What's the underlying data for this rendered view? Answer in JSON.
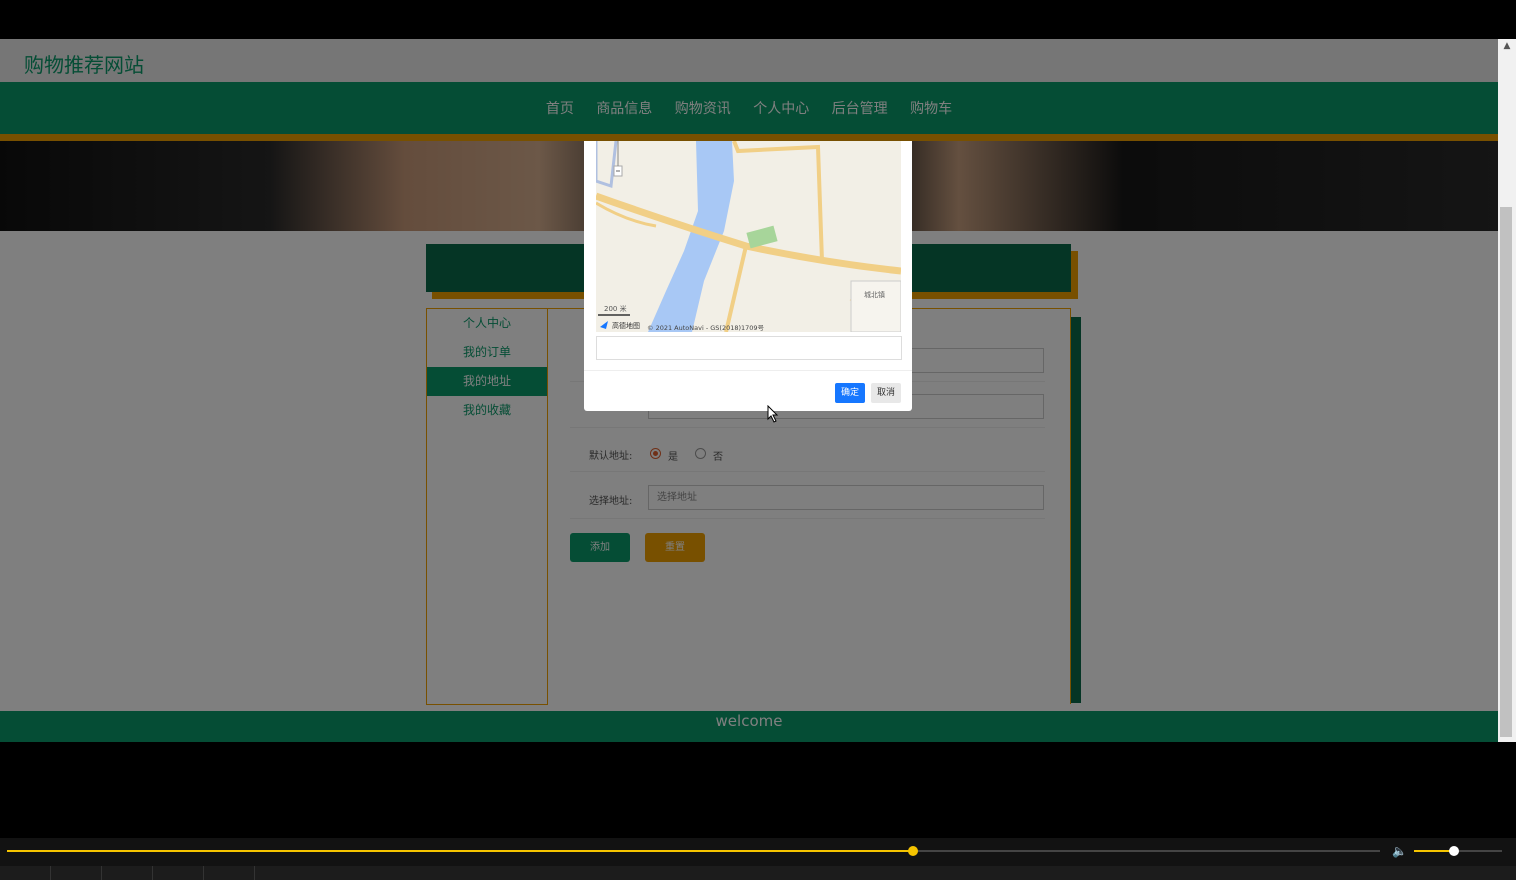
{
  "site": {
    "title": "购物推荐网站"
  },
  "nav": {
    "items": [
      "首页",
      "商品信息",
      "购物资讯",
      "个人中心",
      "后台管理",
      "购物车"
    ]
  },
  "sidebar": {
    "items": [
      {
        "label": "个人中心",
        "active": false
      },
      {
        "label": "我的订单",
        "active": false
      },
      {
        "label": "我的地址",
        "active": true
      },
      {
        "label": "我的收藏",
        "active": false
      }
    ]
  },
  "form": {
    "default_label": "默认地址:",
    "default_options": [
      {
        "label": "是",
        "checked": true
      },
      {
        "label": "否",
        "checked": false
      }
    ],
    "select_label": "选择地址:",
    "select_placeholder": "选择地址",
    "add_button": "添加",
    "reset_button": "重置"
  },
  "footer": {
    "text": "welcome"
  },
  "map_dialog": {
    "scale": "200 米",
    "provider": "高德地图",
    "copyright": "© 2021 AutoNavi - GS(2018)1709号",
    "place_label": "城北镇",
    "ok_button": "确定",
    "cancel_button": "取消"
  },
  "player": {
    "progress": 0.66,
    "volume": 0.45
  },
  "colors": {
    "primary": "#0a9b6b",
    "accent": "#f0a000",
    "dark": "#0a6b4b",
    "ok": "#1677ff"
  }
}
